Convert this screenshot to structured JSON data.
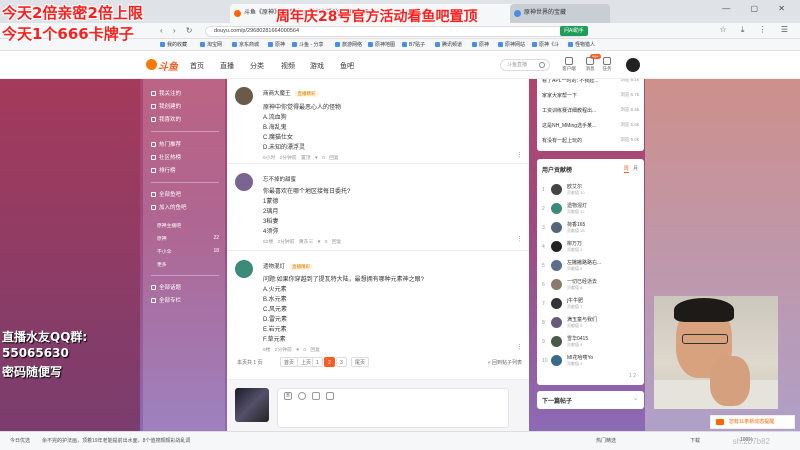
{
  "overlay": {
    "line1": "今天2倍亲密2倍上限",
    "line2": "今天1个666卡牌子",
    "promo": "周年庆28号官方活动看鱼吧置顶",
    "qq_line1": "直播水友QQ群:",
    "qq_line2": "55065630",
    "qq_line3": "密码随便写"
  },
  "browser": {
    "tabs": [
      "斗鱼《原神》#周年庆28号官方活动看鱼吧置顶",
      "原神世界的宝藏"
    ],
    "url": "douyu.com/p/29680281664000564",
    "ask_button": "问AI助手",
    "bookmarks": [
      "我的收藏",
      "淘宝网",
      "京东商城",
      "原神",
      "斗鱼 - 分享",
      "旅游网络",
      "原神地图",
      "B7贴子",
      "腾讯频道",
      "原神",
      "原神网站",
      "原神《斗",
      "怪物猎人"
    ]
  },
  "site": {
    "logo": "斗鱼",
    "nav": [
      "首页",
      "直播",
      "分类",
      "视频",
      "游戏",
      "鱼吧"
    ],
    "search_placeholder": "斗鱼直播",
    "top_actions": [
      "客户端",
      "消息",
      "任务",
      "历史"
    ],
    "badge": "99+"
  },
  "sidebar": {
    "items": [
      "我关注的",
      "我创建的",
      "我喜欢的",
      "热门推荐",
      "社区热榜",
      "排行榜",
      "全部鱼吧",
      "加入的鱼吧",
      "原神主播吧",
      "原神",
      "不小伞",
      "更多",
      "全部话题",
      "全部专栏"
    ],
    "counts": [
      "22",
      "18"
    ]
  },
  "posts": [
    {
      "author": "商商大魔王",
      "tag": "直播精彩",
      "lines": [
        "原神中你觉得最恶心人的怪物",
        "A.流血狗",
        "B.海乱鬼",
        "C.魔猫仕女",
        "D.未知的漂浮灵"
      ],
      "meta": "6小时  2分钟前  置顶  ♥ 0  回复"
    },
    {
      "author": "忘不掉的甜蜜",
      "lines": [
        "你最喜欢在哪个地区接每日委托?",
        "1蒙德",
        "2璃月",
        "3稻妻",
        "4须弥"
      ],
      "meta": "62楼  2分钟前  黄东三  ♥ 0  回复"
    },
    {
      "author": "遗物混灯",
      "tag": "直播精彩",
      "lines": [
        "问题:如果你穿越到了提瓦特大陆，最想拥有哪种元素神之眼?",
        "A.火元素",
        "B.水元素",
        "C.风元素",
        "D.雷元素",
        "E.岩元素",
        "F.草元素"
      ],
      "meta": "6楼  2分钟前  ♥ 0  回复"
    }
  ],
  "pager": {
    "summary": "本页共 1 页",
    "first": "首页",
    "prev": "上页",
    "pages": [
      "1",
      "2",
      "3"
    ],
    "next": "尾页",
    "back": "« 回到帖子列表"
  },
  "hot": {
    "items": [
      {
        "title": "看了APL一时的: 不我起...",
        "count": "浏览 8.1k"
      },
      {
        "title": "家家大家帮一下",
        "count": "浏览 6.7k"
      },
      {
        "title": "工资训练赛详细教程出...",
        "count": "浏览 8.4k"
      },
      {
        "title": "这是NH_MMing选手某...",
        "count": "浏览 5.6k"
      },
      {
        "title": "有没有一起上玩的",
        "count": "浏览 9.0k"
      }
    ]
  },
  "rank": {
    "title": "用户贡献榜",
    "tabs": [
      "周",
      "月"
    ],
    "rows": [
      {
        "rank": "1",
        "name": "欧艾尔",
        "sub": "贡献值 10"
      },
      {
        "rank": "2",
        "name": "遗物混灯",
        "sub": "贡献值 12"
      },
      {
        "rank": "3",
        "name": "荷香165",
        "sub": "贡献值 18"
      },
      {
        "rank": "4",
        "name": "柳万万",
        "sub": "贡献值 4"
      },
      {
        "rank": "5",
        "name": "左撇撇路路右...",
        "sub": "贡献值 6"
      },
      {
        "rank": "6",
        "name": "一切已经逝去",
        "sub": "贡献值 8"
      },
      {
        "rank": "7",
        "name": "j牛牛肥",
        "sub": "贡献值 7"
      },
      {
        "rank": "8",
        "name": "满玉童与我们",
        "sub": "贡献值 5"
      },
      {
        "rank": "9",
        "name": "雪华0415",
        "sub": "贡献值 4"
      },
      {
        "rank": "10",
        "name": "MI花哈喽Yo",
        "sub": "贡献值 3"
      }
    ],
    "pager": "1 2"
  },
  "next_post": "下一篇帖子",
  "notification": "您有11条新动态提醒",
  "statusbar": {
    "left": "今日优选",
    "news": "余不完的护法画，顶着19年老能提前出水面，8个值搜颇颇彩战乱调",
    "right": [
      "热门精选",
      "下载",
      "100%"
    ]
  },
  "watermark": "sh.2b7b82"
}
